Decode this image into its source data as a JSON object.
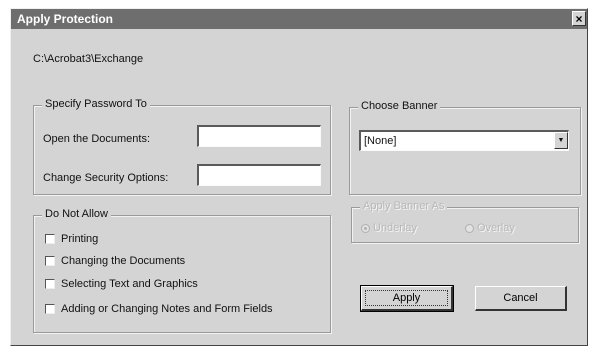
{
  "window": {
    "title": "Apply Protection",
    "close_glyph": "×"
  },
  "path": "C:\\Acrobat3\\Exchange",
  "password_group": {
    "legend": "Specify Password To",
    "open_label": "Open the Documents:",
    "open_value": "",
    "change_label": "Change Security Options:",
    "change_value": ""
  },
  "banner": {
    "label": "Choose Banner",
    "selected": "[None]",
    "arrow_icon": "▼"
  },
  "do_not_allow": {
    "legend": "Do Not Allow",
    "items": [
      {
        "label": "Printing",
        "checked": false
      },
      {
        "label": "Changing the Documents",
        "checked": false
      },
      {
        "label": "Selecting Text and Graphics",
        "checked": false
      },
      {
        "label": "Adding or Changing Notes and Form Fields",
        "checked": false
      }
    ]
  },
  "apply_banner_as": {
    "legend": "Apply Banner As",
    "options": [
      {
        "label": "Underlay",
        "selected": true
      },
      {
        "label": "Overlay",
        "selected": false
      }
    ],
    "enabled": false
  },
  "buttons": {
    "apply": "Apply",
    "cancel": "Cancel"
  }
}
